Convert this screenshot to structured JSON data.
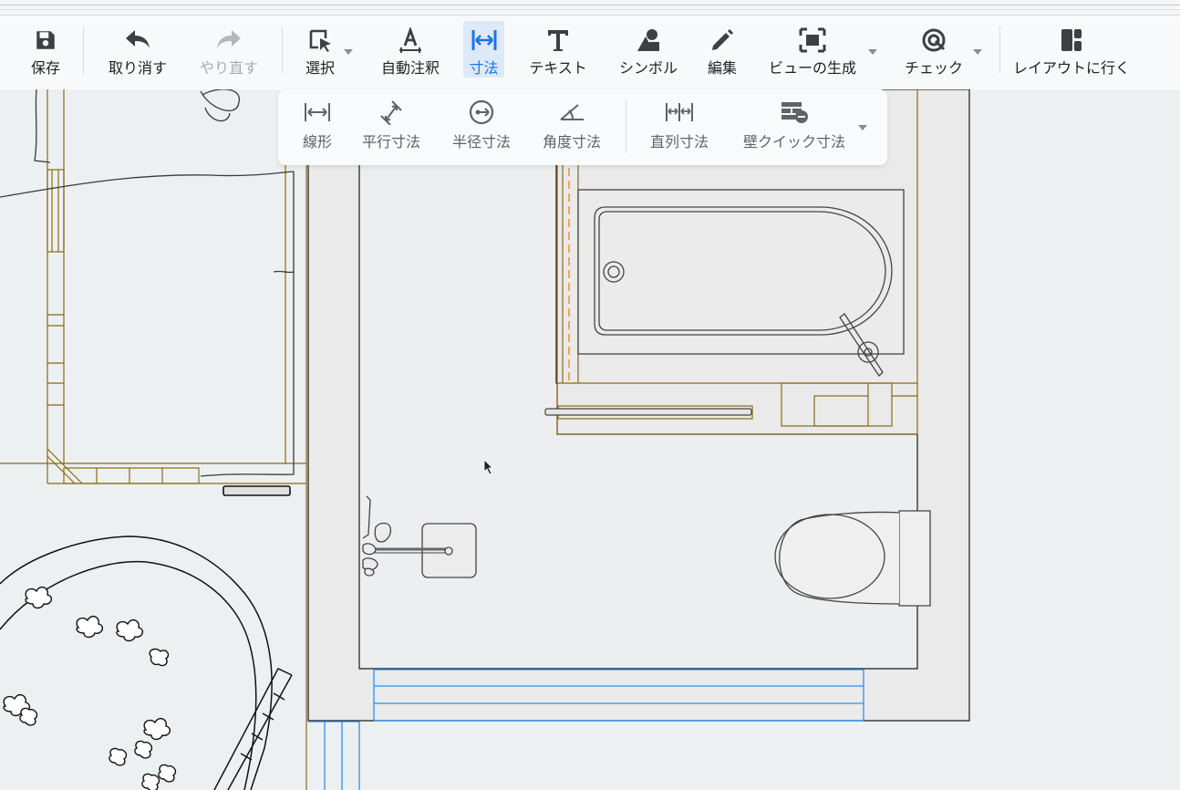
{
  "toolbar": {
    "items": [
      {
        "label": "保存",
        "icon": "save-icon"
      },
      {
        "label": "取り消す",
        "icon": "undo-icon"
      },
      {
        "label": "やり直す",
        "icon": "redo-icon",
        "disabled": true
      },
      {
        "label": "選択",
        "icon": "select-cursor-icon",
        "dropdown": true
      },
      {
        "label": "自動注釈",
        "icon": "auto-annotate-icon"
      },
      {
        "label": "寸法",
        "icon": "dimension-icon",
        "active": true
      },
      {
        "label": "テキスト",
        "icon": "text-icon"
      },
      {
        "label": "シンボル",
        "icon": "symbol-icon"
      },
      {
        "label": "編集",
        "icon": "pencil-icon"
      },
      {
        "label": "ビューの生成",
        "icon": "generate-view-icon",
        "dropdown": true
      },
      {
        "label": "チェック",
        "icon": "check-target-icon",
        "dropdown": true
      },
      {
        "label": "レイアウトに行く",
        "icon": "layout-icon"
      }
    ]
  },
  "dimension_subbar": {
    "items": [
      {
        "label": "線形",
        "icon": "linear-dimension-icon"
      },
      {
        "label": "平行寸法",
        "icon": "aligned-dimension-icon"
      },
      {
        "label": "半径寸法",
        "icon": "radius-dimension-icon"
      },
      {
        "label": "角度寸法",
        "icon": "angle-dimension-icon"
      },
      {
        "label": "直列寸法",
        "icon": "chain-dimension-icon"
      },
      {
        "label": "壁クイック寸法",
        "icon": "wall-quick-dimension-icon",
        "dropdown": true
      }
    ]
  },
  "colors": {
    "accent": "#1a73e8",
    "wall_outline": "#8a6a10",
    "selected_line": "#2b8ff0",
    "door_swing": "#f0902a",
    "canvas": "#edf0f1"
  }
}
